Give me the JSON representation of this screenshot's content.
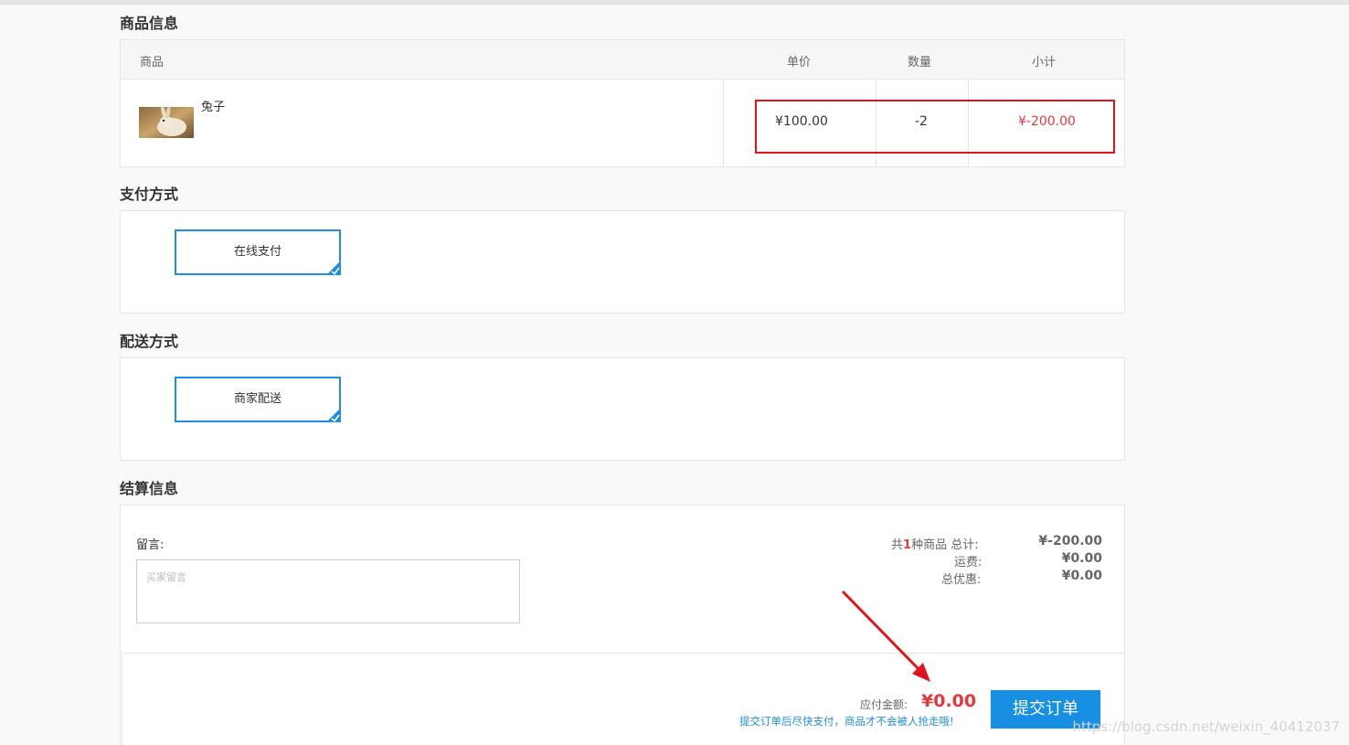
{
  "sections": {
    "product_info": "商品信息",
    "payment_method": "支付方式",
    "delivery_method": "配送方式",
    "checkout_info": "结算信息"
  },
  "table": {
    "headers": [
      "商品",
      "单价",
      "数量",
      "小计"
    ],
    "row": {
      "name": "兔子",
      "unit_price": "¥100.00",
      "quantity": "-2",
      "subtotal": "¥-200.00"
    }
  },
  "payment": {
    "option": "在线支付"
  },
  "delivery": {
    "option": "商家配送"
  },
  "message": {
    "label": "留言:",
    "placeholder": "买家留言"
  },
  "summary": {
    "count_prefix": "共",
    "count": "1",
    "count_suffix": "种商品 总计:",
    "total": "¥-200.00",
    "shipping_label": "运费:",
    "shipping": "¥0.00",
    "discount_label": "总优惠:",
    "discount": "¥0.00"
  },
  "payable": {
    "label": "应付金额:",
    "amount": "¥0.00",
    "hint": "提交订单后尽快支付，商品才不会被人抢走哦!"
  },
  "submit_label": "提交订单",
  "watermark": "https://blog.csdn.net/weixin_40412037",
  "colors": {
    "accent": "#1790e4",
    "price_red": "#e4393c",
    "annotation_red": "#e0141a"
  }
}
